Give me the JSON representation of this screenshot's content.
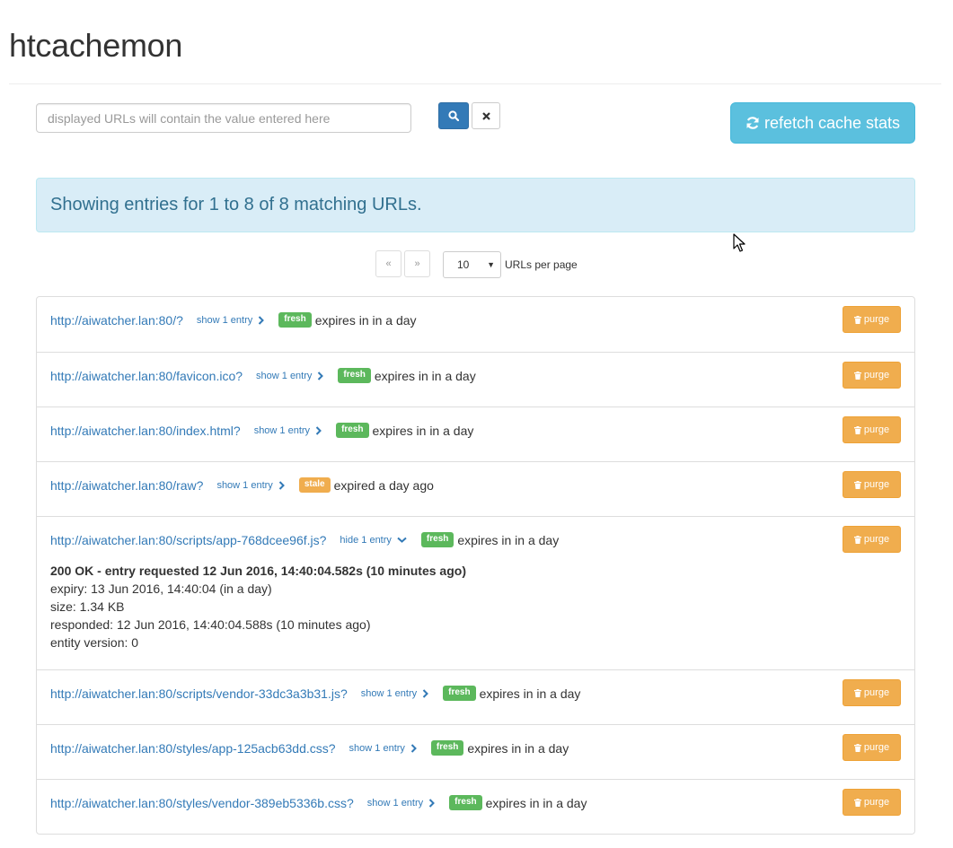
{
  "app": {
    "title": "htcachemon"
  },
  "search": {
    "placeholder": "displayed URLs will contain the value entered here",
    "value": ""
  },
  "toolbar": {
    "refetch_label": "refetch cache stats"
  },
  "alert": {
    "text": "Showing entries for 1 to 8 of 8 matching URLs."
  },
  "pagination": {
    "prev_label": "«",
    "next_label": "»",
    "per_page_value": "10",
    "per_page_label": "URLs per page"
  },
  "entries": [
    {
      "url": "http://aiwatcher.lan:80/?",
      "toggle": "show 1 entry",
      "status": "fresh",
      "expiry": "expires in in a day",
      "purge": "purge"
    },
    {
      "url": "http://aiwatcher.lan:80/favicon.ico?",
      "toggle": "show 1 entry",
      "status": "fresh",
      "expiry": "expires in in a day",
      "purge": "purge"
    },
    {
      "url": "http://aiwatcher.lan:80/index.html?",
      "toggle": "show 1 entry",
      "status": "fresh",
      "expiry": "expires in in a day",
      "purge": "purge"
    },
    {
      "url": "http://aiwatcher.lan:80/raw?",
      "toggle": "show 1 entry",
      "status": "stale",
      "expiry": "expired a day ago",
      "purge": "purge"
    },
    {
      "url": "http://aiwatcher.lan:80/scripts/app-768dcee96f.js?",
      "toggle": "hide 1 entry",
      "status": "fresh",
      "expiry": "expires in in a day",
      "purge": "purge",
      "detail": {
        "headline": "200 OK - entry requested 12 Jun 2016, 14:40:04.582s (10 minutes ago)",
        "expiry": "expiry: 13 Jun 2016, 14:40:04 (in a day)",
        "size": "size: 1.34 KB",
        "responded": "responded: 12 Jun 2016, 14:40:04.588s (10 minutes ago)",
        "version": "entity version: 0"
      }
    },
    {
      "url": "http://aiwatcher.lan:80/scripts/vendor-33dc3a3b31.js?",
      "toggle": "show 1 entry",
      "status": "fresh",
      "expiry": "expires in in a day",
      "purge": "purge"
    },
    {
      "url": "http://aiwatcher.lan:80/styles/app-125acb63dd.css?",
      "toggle": "show 1 entry",
      "status": "fresh",
      "expiry": "expires in in a day",
      "purge": "purge"
    },
    {
      "url": "http://aiwatcher.lan:80/styles/vendor-389eb5336b.css?",
      "toggle": "show 1 entry",
      "status": "fresh",
      "expiry": "expires in in a day",
      "purge": "purge"
    }
  ],
  "colors": {
    "primary": "#337ab7",
    "info": "#5bc0de",
    "success": "#5cb85c",
    "warning": "#f0ad4e",
    "alert_bg": "#d9edf7",
    "alert_text": "#31708f"
  },
  "icons": {
    "search_button": "search-icon",
    "clear_button": "close-icon",
    "refetch_button": "refresh-icon",
    "purge_button": "trash-icon",
    "toggle_collapsed": "chevron-right-icon",
    "toggle_expanded": "chevron-down-icon"
  }
}
